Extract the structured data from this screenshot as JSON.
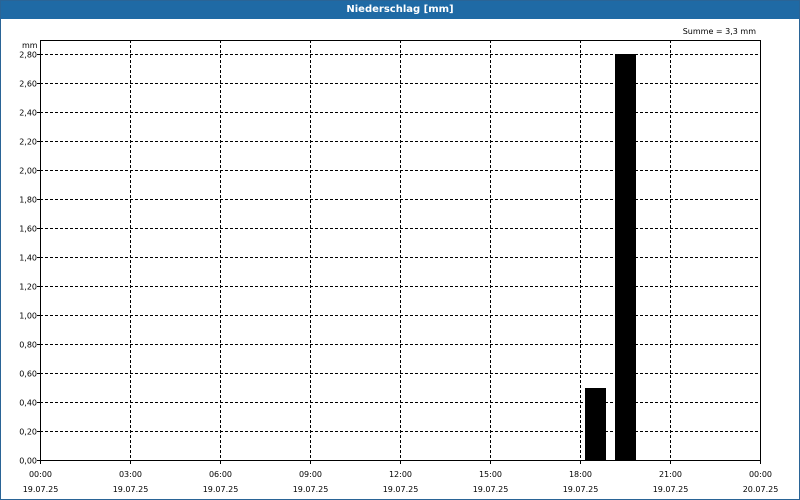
{
  "window": {
    "title": "Niederschlag [mm]"
  },
  "chart_data": {
    "type": "bar",
    "title": "Niederschlag [mm]",
    "ylabel": "mm",
    "annotation": "Summe = 3,3 mm",
    "ylim": [
      0,
      2.9
    ],
    "grid": true,
    "y_ticks": [
      "0,00",
      "0,20",
      "0,40",
      "0,60",
      "0,80",
      "1,00",
      "1,20",
      "1,40",
      "1,60",
      "1,80",
      "2,00",
      "2,20",
      "2,40",
      "2,60",
      "2,80"
    ],
    "x_ticks": [
      {
        "time": "00:00",
        "date": "19.07.25"
      },
      {
        "time": "03:00",
        "date": "19.07.25"
      },
      {
        "time": "06:00",
        "date": "19.07.25"
      },
      {
        "time": "09:00",
        "date": "19.07.25"
      },
      {
        "time": "12:00",
        "date": "19.07.25"
      },
      {
        "time": "15:00",
        "date": "19.07.25"
      },
      {
        "time": "18:00",
        "date": "19.07.25"
      },
      {
        "time": "21:00",
        "date": "19.07.25"
      },
      {
        "time": "00:00",
        "date": "20.07.25"
      }
    ],
    "xlim": [
      "19.07.25 00:00",
      "20.07.25 00:00"
    ],
    "bars": [
      {
        "x": "19.07.25 18:30",
        "value": 0.5
      },
      {
        "x": "19.07.25 19:30",
        "value": 2.8
      }
    ],
    "bar_color": "#000000"
  }
}
